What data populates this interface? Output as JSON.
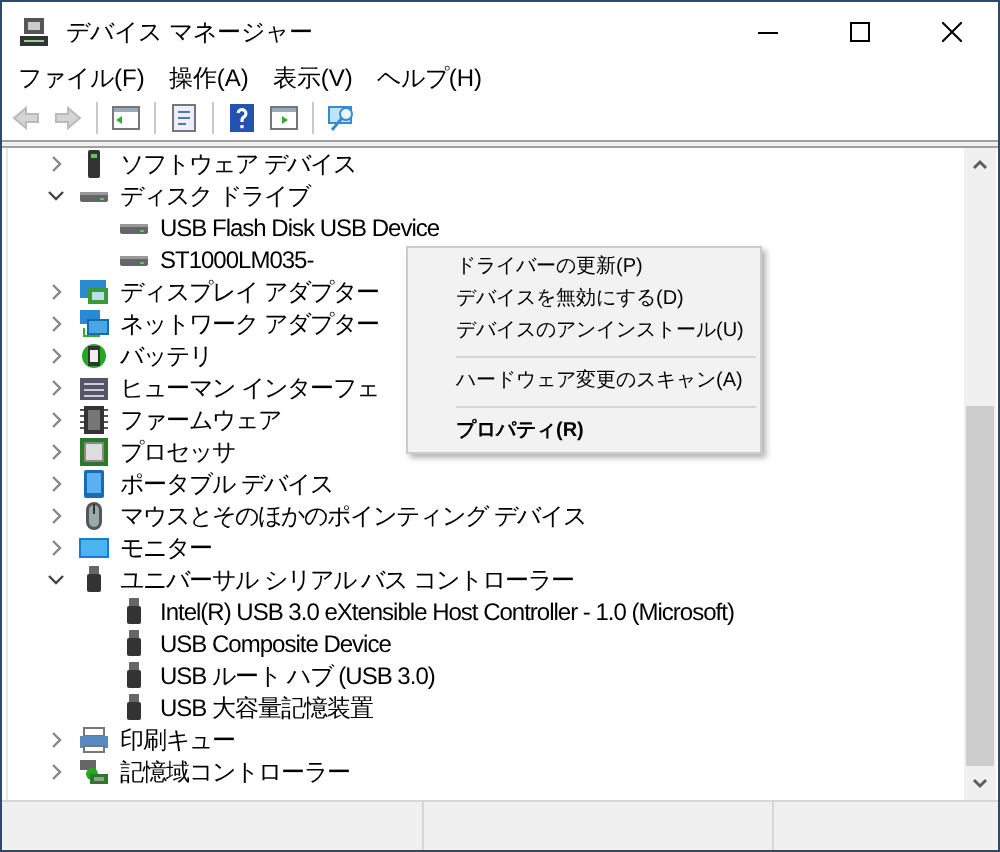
{
  "window": {
    "title": "デバイス マネージャー"
  },
  "menu_bar": [
    "ファイル(F)",
    "操作(A)",
    "表示(V)",
    "ヘルプ(H)"
  ],
  "toolbar": [
    {
      "kind": "back",
      "disabled": true
    },
    {
      "kind": "forward",
      "disabled": true
    },
    {
      "kind": "separator"
    },
    {
      "kind": "pane",
      "disabled": false
    },
    {
      "kind": "separator"
    },
    {
      "kind": "properties",
      "disabled": false
    },
    {
      "kind": "separator"
    },
    {
      "kind": "help",
      "disabled": false
    },
    {
      "kind": "action",
      "disabled": false
    },
    {
      "kind": "separator"
    },
    {
      "kind": "scan",
      "disabled": false
    }
  ],
  "tree": [
    {
      "label": "ソフトウェア デバイス",
      "kind": "phone",
      "expanded": false
    },
    {
      "label": "ディスク ドライブ",
      "kind": "drive",
      "expanded": true,
      "children": [
        {
          "label": "USB Flash Disk USB Device",
          "kind": "drive"
        },
        {
          "label": "ST1000LM035-",
          "kind": "drive"
        }
      ]
    },
    {
      "label": "ディスプレイ アダプター",
      "kind": "display",
      "expanded": false
    },
    {
      "label": "ネットワーク アダプター",
      "kind": "network",
      "expanded": false
    },
    {
      "label": "バッテリ",
      "kind": "battery",
      "expanded": false
    },
    {
      "label": "ヒューマン インターフェ",
      "kind": "keyboard",
      "expanded": false
    },
    {
      "label": "ファームウェア",
      "kind": "firmware",
      "expanded": false
    },
    {
      "label": "プロセッサ",
      "kind": "processor",
      "expanded": false
    },
    {
      "label": "ポータブル デバイス",
      "kind": "portable",
      "expanded": false
    },
    {
      "label": "マウスとそのほかのポインティング デバイス",
      "kind": "mouse",
      "expanded": false
    },
    {
      "label": "モニター",
      "kind": "monitor",
      "expanded": false
    },
    {
      "label": "ユニバーサル シリアル バス コントローラー",
      "kind": "usb",
      "expanded": true,
      "children": [
        {
          "label": "Intel(R) USB 3.0 eXtensible Host Controller - 1.0 (Microsoft)",
          "kind": "usb"
        },
        {
          "label": "USB Composite Device",
          "kind": "usb"
        },
        {
          "label": "USB ルート ハブ (USB 3.0)",
          "kind": "usb"
        },
        {
          "label": "USB 大容量記憶装置",
          "kind": "usb"
        }
      ]
    },
    {
      "label": "印刷キュー",
      "kind": "printer",
      "expanded": false
    },
    {
      "label": "記憶域コントローラー",
      "kind": "storage",
      "expanded": false
    }
  ],
  "context_menu": [
    {
      "kind": "item",
      "label": "ドライバーの更新(P)"
    },
    {
      "kind": "item",
      "label": "デバイスを無効にする(D)"
    },
    {
      "kind": "item",
      "label": "デバイスのアンインストール(U)"
    },
    {
      "kind": "separator"
    },
    {
      "kind": "item",
      "label": "ハードウェア変更のスキャン(A)"
    },
    {
      "kind": "separator"
    },
    {
      "kind": "default",
      "label": "プロパティ(R)"
    }
  ]
}
